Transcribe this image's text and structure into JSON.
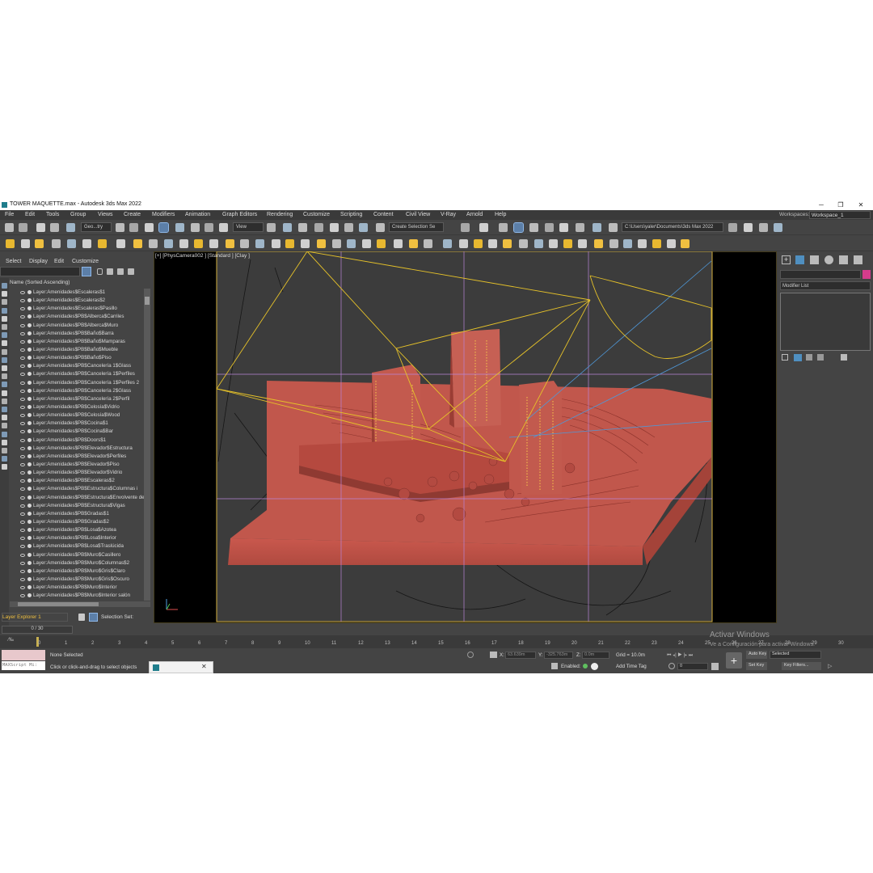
{
  "window": {
    "title": "TOWER MAQUETTE.max - Autodesk 3ds Max 2022",
    "min_glyph": "─",
    "max_glyph": "❐",
    "close_glyph": "✕"
  },
  "menu": {
    "items": [
      "File",
      "Edit",
      "Tools",
      "Group",
      "Views",
      "Create",
      "Modifiers",
      "Animation",
      "Graph Editors",
      "Rendering",
      "Customize",
      "Scripting",
      "Content",
      "Civil View",
      "V-Ray",
      "Arnold",
      "Help"
    ],
    "workspaces_label": "Workspaces:",
    "workspace_value": "Workspace_1"
  },
  "toolbar": {
    "filter_dropdown": "Geo...try",
    "refcoord_dropdown": "View",
    "selection_set_dropdown": "Create Selection Se",
    "project_path": "C:\\Users\\yaler\\Documents\\3ds Max 2022"
  },
  "explorer": {
    "menu": [
      "Select",
      "Display",
      "Edit",
      "Customize"
    ],
    "column_header": "Name (Sorted Ascending)",
    "layers": [
      "Layer:Amenidades$Escaleras$1",
      "Layer:Amenidades$Escaleras$2",
      "Layer:Amenidades$Escaleras$Pasillo",
      "Layer:Amenidades$PB$Alberca$Carriles",
      "Layer:Amenidades$PB$Alberca$Muro",
      "Layer:Amenidades$PB$Baño$Barra",
      "Layer:Amenidades$PB$Baño$Mamparas",
      "Layer:Amenidades$PB$Baño$Mueble",
      "Layer:Amenidades$PB$Baño$Piso",
      "Layer:Amenidades$PB$Cancelería 1$Glass",
      "Layer:Amenidades$PB$Cancelería 1$Perfiles",
      "Layer:Amenidades$PB$Cancelería 1$Perfiles 2",
      "Layer:Amenidades$PB$Cancelería 2$Glass",
      "Layer:Amenidades$PB$Cancelería 2$Perfil",
      "Layer:Amenidades$PB$Celosía$Vidrio",
      "Layer:Amenidades$PB$Celosía$Wood",
      "Layer:Amenidades$PB$Cocina$1",
      "Layer:Amenidades$PB$Cocina$Bar",
      "Layer:Amenidades$PB$Doors$1",
      "Layer:Amenidades$PB$Elevador$Estructura",
      "Layer:Amenidades$PB$Elevador$Perfiles",
      "Layer:Amenidades$PB$Elevador$Piso",
      "Layer:Amenidades$PB$Elevador$Vidrio",
      "Layer:Amenidades$PB$Escaleras$2",
      "Layer:Amenidades$PB$Estructura$Columnas i",
      "Layer:Amenidades$PB$Estructura$Envolvente de",
      "Layer:Amenidades$PB$Estructura$Vigas",
      "Layer:Amenidades$PB$Gradas$1",
      "Layer:Amenidades$PB$Gradas$2",
      "Layer:Amenidades$PB$Losa$Azotea",
      "Layer:Amenidades$PB$Losa$Interior",
      "Layer:Amenidades$PB$Losa$Traslúcida",
      "Layer:Amenidades$PB$Muro$Casillero",
      "Layer:Amenidades$PB$Muro$Columnas$2",
      "Layer:Amenidades$PB$Muro$Gris$Claro",
      "Layer:Amenidades$PB$Muro$Gris$Oscuro",
      "Layer:Amenidades$PB$Muro$Interior",
      "Layer:Amenidades$PB$Muro$Interior salón",
      "Layer:Amenidades$PB$Muro$Wood"
    ],
    "layer_explorer_label": "Layer Explorer 1",
    "selection_set_label": "Selection Set:"
  },
  "viewport": {
    "label": "[+] [PhysCamera002 ] [Standard ] [Clay ]"
  },
  "command_panel": {
    "modifier_list": "Modifier List"
  },
  "timeline": {
    "frame_counter": "0 / 30",
    "ticks": [
      "0",
      "1",
      "2",
      "3",
      "4",
      "5",
      "6",
      "7",
      "8",
      "9",
      "10",
      "11",
      "12",
      "13",
      "14",
      "15",
      "16",
      "17",
      "18",
      "19",
      "20",
      "21",
      "22",
      "23",
      "24",
      "25",
      "26",
      "27",
      "28",
      "29",
      "30"
    ]
  },
  "status": {
    "maxscript": "MAXScript Mi:",
    "selection": "None Selected",
    "prompt": "Click or click-and-drag to select objects",
    "x_label": "X:",
    "x_value": "63.639m",
    "y_label": "Y:",
    "y_value": "-325.763m",
    "z_label": "Z:",
    "z_value": "0.0m",
    "grid": "Grid = 10.0m",
    "enabled_label": "Enabled:",
    "add_time_tag": "Add Time Tag",
    "auto_key": "Auto Key",
    "selected_dropdown": "Selected",
    "set_key": "Set Key",
    "key_filters": "Key Filters...",
    "frame_field": "0"
  },
  "watermark": {
    "line1": "Activar Windows",
    "line2": "Ve a Configuración para activar Windows."
  },
  "colors": {
    "model": "#c1574c",
    "camera_lines": "#e6c229",
    "selection_frame": "#d4b040",
    "guides": "#b884d8",
    "light_lines": "#4f98d8"
  }
}
